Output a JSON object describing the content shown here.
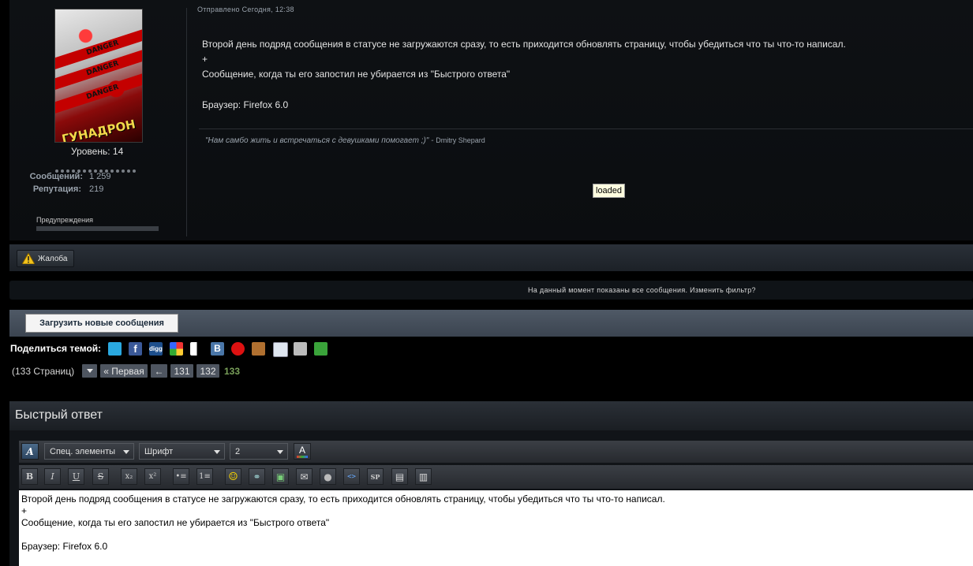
{
  "user": {
    "level": "Уровень: 14",
    "posts_label": "Сообщений:",
    "posts_value": "1 259",
    "rep_label": "Репутация:",
    "rep_value": "219",
    "warnings_label": "Предупреждения",
    "avatar_caption": "ГУНАДРОН",
    "avatar_band_text": "DANGER"
  },
  "post": {
    "posted": "Отправлено Сегодня, 12:38",
    "lines": [
      "Второй день подряд сообщения в статусе не загружаются сразу, то есть приходится обновлять страницу, чтобы убедиться что ты что-то написал.",
      "+",
      "Сообщение, когда ты его запостил не убирается из \"Быстрого ответа\"",
      "",
      "Браузер: Firefox 6.0"
    ],
    "signature_quote": "\"Нам самбо жить и встречаться с девушками помогает ;)\" -",
    "signature_author": "Dmitry Shepard",
    "tooltip": "loaded"
  },
  "report_button": "Жалоба",
  "filter_text": "На данный момент показаны все сообщения. Изменить фильтр?",
  "load_new_button": "Загрузить новые сообщения",
  "share": {
    "label": "Поделиться темой:",
    "icons": [
      "twitter-icon",
      "facebook-icon",
      "digg-icon",
      "google-icon",
      "delicious-icon",
      "vkontakte-icon",
      "myspace-icon",
      "mail-agent-icon",
      "email-icon",
      "print-icon",
      "download-icon"
    ]
  },
  "pagination": {
    "total": "(133 Страниц)",
    "first": "« Первая",
    "prev": "←",
    "p131": "131",
    "p132": "132",
    "current": "133"
  },
  "quick_reply": {
    "title": "Быстрый ответ",
    "special_select": "Спец. элементы",
    "font_select": "Шрифт",
    "size_select": "2",
    "text_lines": [
      "Второй день подряд сообщения в статусе не загружаются сразу, то есть приходится обновлять страницу, чтобы убедиться что ты что-то написал.",
      "+",
      "Сообщение, когда ты его запостил не убирается из \"Быстрого ответа\"",
      "",
      "Браузер: Firefox 6.0"
    ]
  },
  "toolbar_buttons": [
    "B",
    "I",
    "U",
    "S",
    "x₂",
    "x²",
    "•≡",
    "1≡",
    "☺",
    "⚭",
    "▣",
    "✉",
    "●",
    "<>",
    "SP",
    "▤",
    "▥"
  ]
}
